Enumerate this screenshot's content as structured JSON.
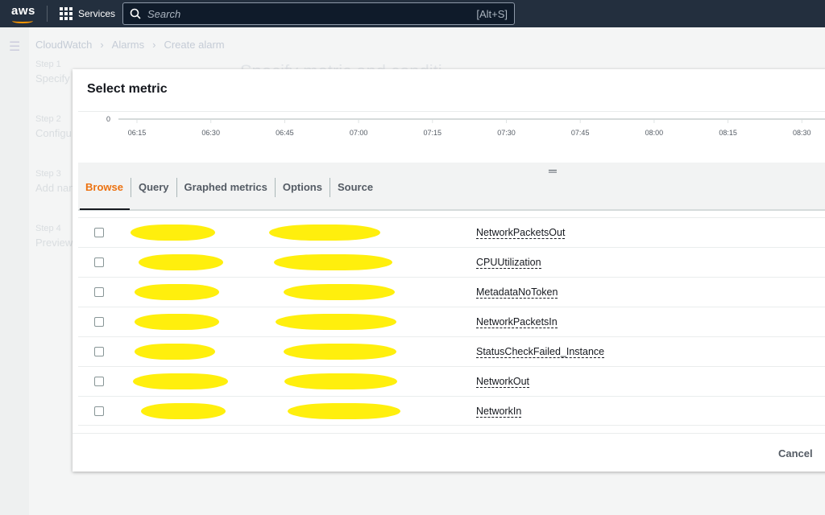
{
  "topbar": {
    "logo": "aws",
    "services": "Services",
    "search_placeholder": "Search",
    "search_shortcut": "[Alt+S]"
  },
  "background": {
    "breadcrumb": [
      "CloudWatch",
      "Alarms",
      "Create alarm"
    ],
    "page_title": "Specify metric and conditi",
    "steps": [
      {
        "label": "Step 1",
        "title": "Specify"
      },
      {
        "label": "Step 2",
        "title": "Configu"
      },
      {
        "label": "Step 3",
        "title": "Add nan"
      },
      {
        "label": "Step 4",
        "title": "Preview"
      }
    ]
  },
  "modal": {
    "title": "Select metric",
    "tabs": [
      {
        "label": "Browse",
        "active": true
      },
      {
        "label": "Query"
      },
      {
        "label": "Graphed metrics"
      },
      {
        "label": "Options"
      },
      {
        "label": "Source"
      }
    ],
    "metrics": [
      {
        "name": "NetworkPacketsOut",
        "checked": false
      },
      {
        "name": "CPUUtilization",
        "checked": false
      },
      {
        "name": "MetadataNoToken",
        "checked": false
      },
      {
        "name": "NetworkPacketsIn",
        "checked": false
      },
      {
        "name": "StatusCheckFailed_Instance",
        "checked": false
      },
      {
        "name": "NetworkOut",
        "checked": false
      },
      {
        "name": "NetworkIn",
        "checked": false
      }
    ],
    "cancel": "Cancel"
  },
  "chart_data": {
    "type": "line",
    "y_ticks": [
      "0"
    ],
    "x_ticks": [
      "06:15",
      "06:30",
      "06:45",
      "07:00",
      "07:15",
      "07:30",
      "07:45",
      "08:00",
      "08:15",
      "08:30"
    ],
    "series": []
  },
  "colors": {
    "topbar": "#232f3e",
    "accent": "#ec7211",
    "redaction": "#ffee00"
  }
}
